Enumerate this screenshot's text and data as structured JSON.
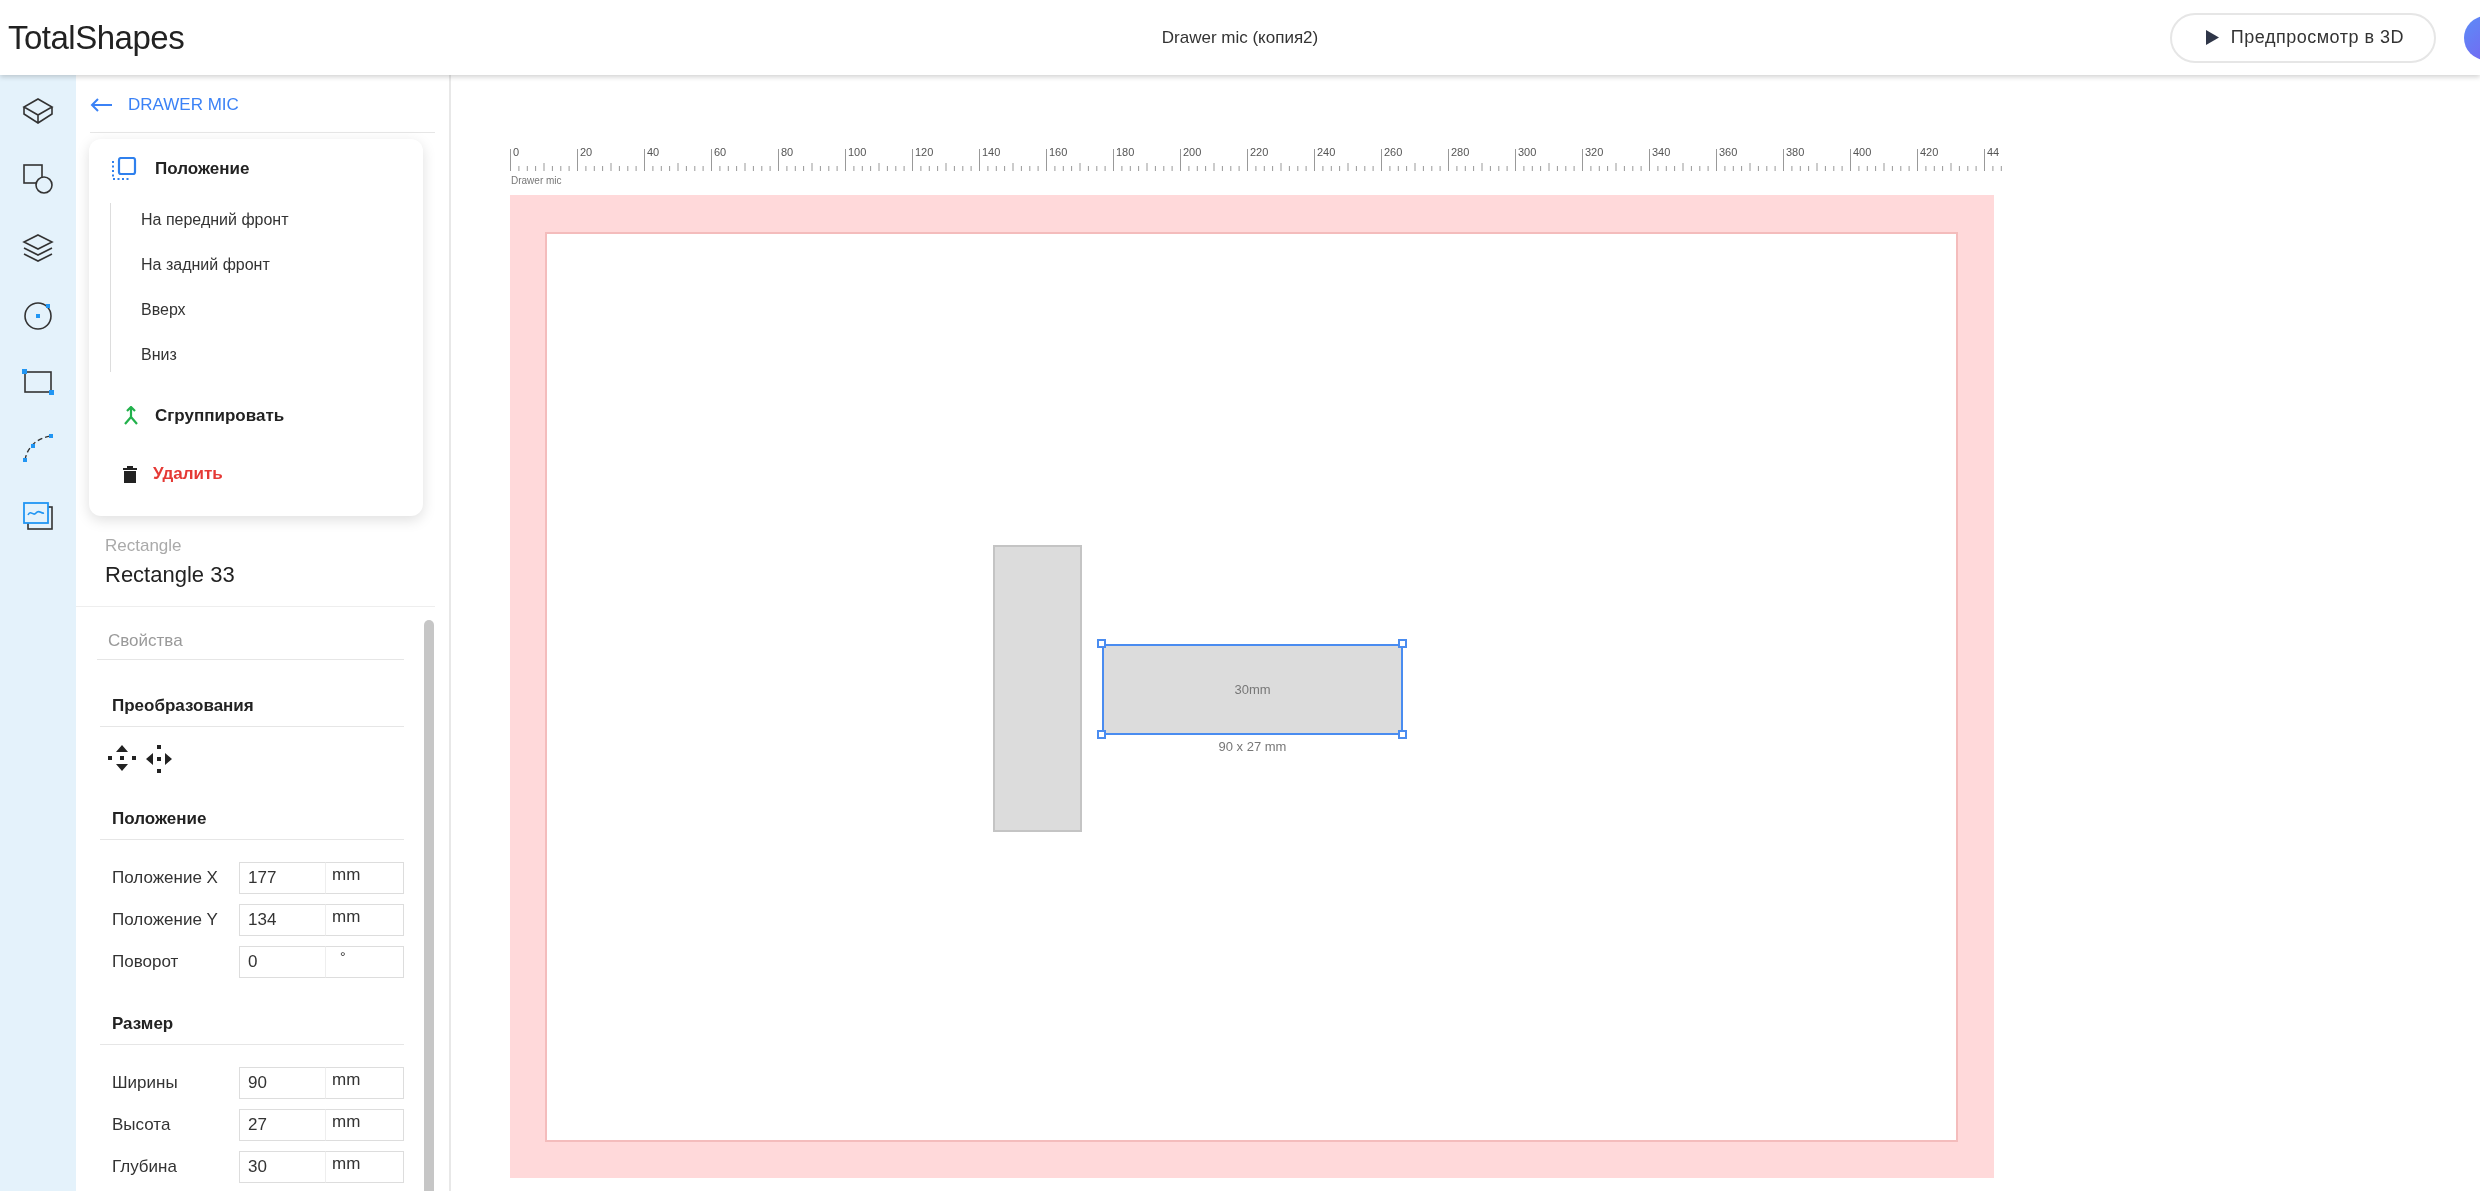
{
  "header": {
    "logo": "TotalShapes",
    "title": "Drawer mic (копия2)",
    "preview_button": "Предпросмотр в 3D"
  },
  "panel": {
    "back_link": "DRAWER MIC",
    "context_menu": {
      "title": "Положение",
      "items": [
        "На передний фронт",
        "На задний фронт",
        "Вверх",
        "Вниз"
      ],
      "actions": [
        {
          "kind": "group",
          "label": "Сгруппировать"
        },
        {
          "kind": "delete",
          "label": "Удалить"
        }
      ]
    },
    "object_type": "Rectangle",
    "object_name": "Rectangle 33",
    "properties_title": "Свойства",
    "sections": [
      {
        "kind": "tools",
        "title": "Преобразования"
      },
      {
        "kind": "fields",
        "title": "Положение",
        "fields": [
          {
            "label": "Положение X",
            "value": "177",
            "unit": "mm"
          },
          {
            "label": "Положение Y",
            "value": "134",
            "unit": "mm"
          },
          {
            "label": "Поворот",
            "value": "0",
            "unit": "°"
          }
        ]
      },
      {
        "kind": "fields",
        "title": "Размер",
        "fields": [
          {
            "label": "Ширины",
            "value": "90",
            "unit": "mm"
          },
          {
            "label": "Высота",
            "value": "27",
            "unit": "mm"
          },
          {
            "label": "Глубина",
            "value": "30",
            "unit": "mm"
          }
        ]
      }
    ]
  },
  "canvas": {
    "ruler_labels": [
      "0",
      "20",
      "40",
      "60",
      "80",
      "100",
      "120",
      "140",
      "160",
      "180",
      "200",
      "220",
      "240",
      "260",
      "280",
      "300",
      "320",
      "340",
      "360",
      "380",
      "400",
      "420",
      "44"
    ],
    "document_label": "Drawer mic",
    "shapes": [
      {
        "kind": "rect",
        "selected": false
      },
      {
        "kind": "rect",
        "selected": true,
        "label": "30mm",
        "dimensions": "90 x 27 mm"
      }
    ]
  }
}
